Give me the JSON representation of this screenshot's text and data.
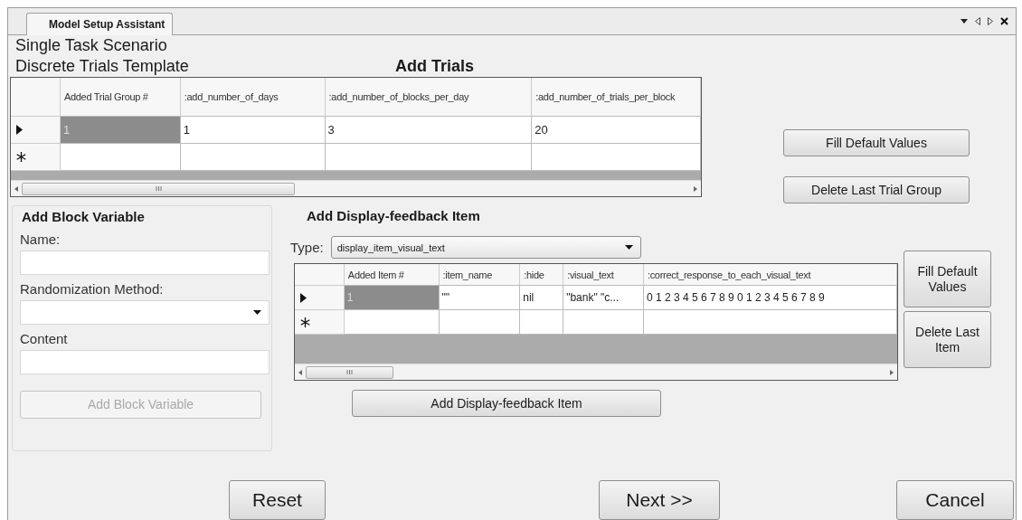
{
  "window": {
    "tab": "Model Setup Assistant"
  },
  "scenario_lines": [
    "Single Task Scenario",
    "Discrete Trials Template"
  ],
  "trials": {
    "title": "Add Trials",
    "columns": [
      "Added Trial Group #",
      ":add_number_of_days",
      ":add_number_of_blocks_per_day",
      ":add_number_of_trials_per_block"
    ],
    "rows": [
      {
        "kind": "current",
        "cells": [
          {
            "text": "1",
            "selected": true
          },
          {
            "text": "1",
            "selected": false
          },
          {
            "text": "3",
            "selected": false
          },
          {
            "text": "20",
            "selected": false
          }
        ]
      },
      {
        "kind": "new"
      }
    ],
    "buttons": [
      {
        "label": "Fill Default Values"
      },
      {
        "label": "Delete Last Trial Group"
      }
    ]
  },
  "block_variable": {
    "title": "Add Block Variable",
    "fields": [
      {
        "kind": "text",
        "label": "Name:"
      },
      {
        "kind": "select",
        "label": "Randomization Method:"
      },
      {
        "kind": "text",
        "label": "Content"
      }
    ],
    "button": {
      "label": "Add Block Variable",
      "disabled": true
    }
  },
  "display_feedback": {
    "title": "Add Display-feedback Item",
    "type_label": "Type:",
    "type_value": "display_item_visual_text",
    "columns": [
      "Added Item #",
      ":item_name",
      ":hide",
      ":visual_text",
      ":correct_response_to_each_visual_text"
    ],
    "rows": [
      {
        "kind": "current",
        "cells": [
          {
            "text": "1",
            "selected": true
          },
          {
            "text": "\"\"",
            "selected": false
          },
          {
            "text": "nil",
            "selected": false
          },
          {
            "text": "\"bank\" \"c...",
            "selected": false
          },
          {
            "text": "0 1 2 3 4 5 6 7 8 9 0 1 2 3 4 5 6 7 8 9",
            "selected": false
          }
        ]
      },
      {
        "kind": "new"
      }
    ],
    "side_buttons": [
      {
        "label": "Fill Default Values"
      },
      {
        "label": "Delete Last Item"
      }
    ],
    "add_button": {
      "label": "Add Display-feedback Item",
      "disabled": false
    }
  },
  "footer_buttons": [
    {
      "label": "Reset"
    },
    {
      "label": "Next >>"
    },
    {
      "label": "Cancel"
    }
  ]
}
